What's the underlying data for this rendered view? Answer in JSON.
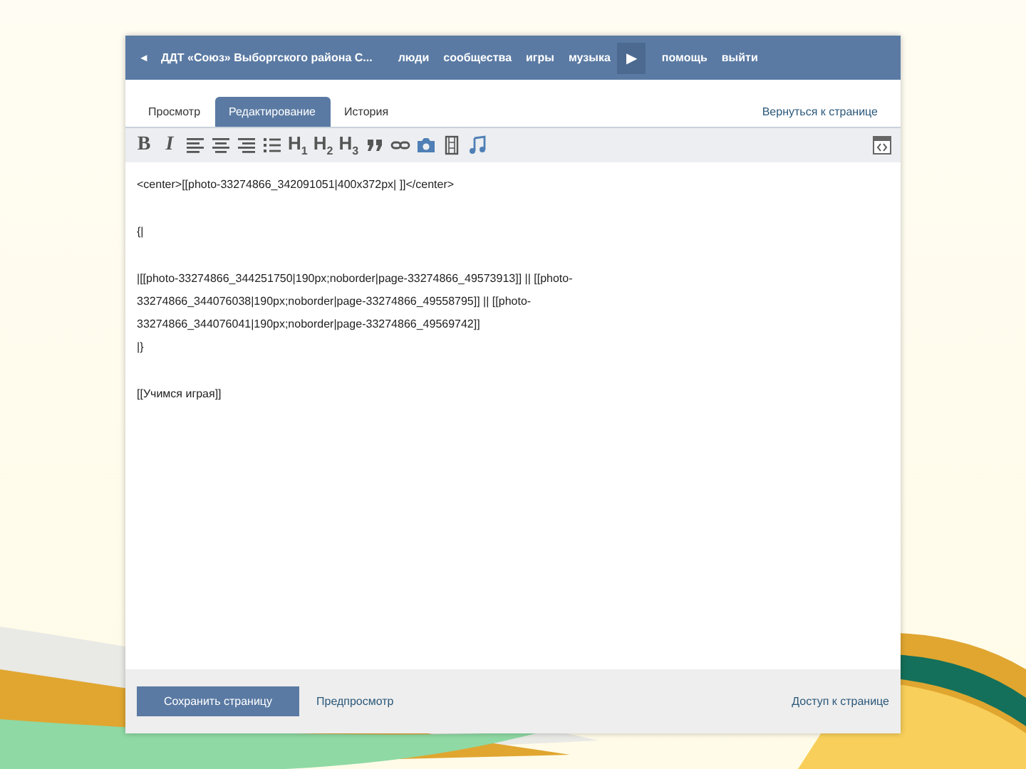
{
  "header": {
    "back": "◂",
    "title": "ДДТ «Союз» Выборгского района С...",
    "nav": [
      "люди",
      "сообщества",
      "игры",
      "музыка"
    ],
    "more": "▶",
    "nav_right": [
      "помощь",
      "выйти"
    ]
  },
  "tabs": [
    {
      "label": "Просмотр",
      "selected": false
    },
    {
      "label": "Редактирование",
      "selected": true
    },
    {
      "label": "История",
      "selected": false
    }
  ],
  "return_link": "Вернуться к странице",
  "toolbar": {
    "bold": "B",
    "italic": "I",
    "headings": [
      "H$_{1}$",
      "H$_{2}$",
      "H$_{3}$"
    ]
  },
  "editor": {
    "blocks": [
      [
        "<center>[[photo-33274866_342091051|400x372px| ]]</center>"
      ],
      [
        "{|"
      ],
      [
        "|[[photo-33274866_344251750|190px;noborder|page-33274866_49573913]] || [[photo-",
        "33274866_344076038|190px;noborder|page-33274866_49558795]] || [[photo-",
        "33274866_344076041|190px;noborder|page-33274866_49569742]]",
        "|}"
      ],
      [
        "[[Учимся играя]]"
      ]
    ]
  },
  "footer": {
    "save": "Сохранить страницу",
    "preview": "Предпросмотр",
    "access": "Доступ к странице"
  }
}
